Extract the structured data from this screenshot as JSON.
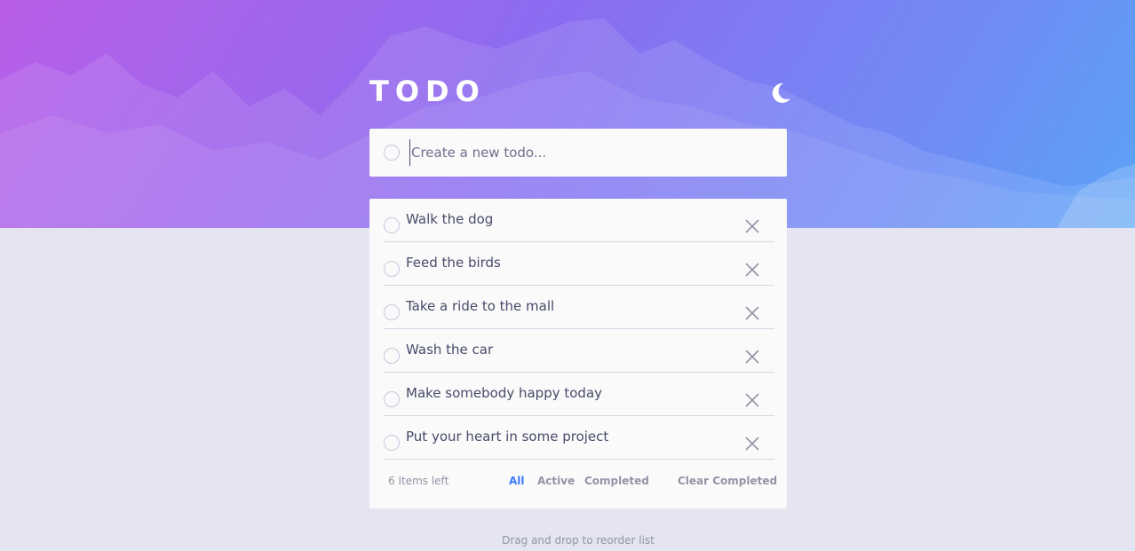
{
  "app": {
    "title": "TODO",
    "theme_icon": "moon-icon"
  },
  "new_todo": {
    "placeholder": "Create a new todo...",
    "value": ""
  },
  "todos": [
    {
      "text": "Walk the dog",
      "completed": false
    },
    {
      "text": "Feed the birds",
      "completed": false
    },
    {
      "text": "Take a ride to the mall",
      "completed": false
    },
    {
      "text": "Wash the car",
      "completed": false
    },
    {
      "text": "Make somebody happy today",
      "completed": false
    },
    {
      "text": "Put your heart in some project",
      "completed": false
    }
  ],
  "footer": {
    "items_left": "6 Items left",
    "filter_all": "All",
    "filter_active": "Active",
    "filter_completed": "Completed",
    "clear_completed": "Clear Completed",
    "active_filter": "All"
  },
  "hint": "Drag and drop to reorder list",
  "colors": {
    "accent": "#3a7bfd",
    "background": "#e4e5f1",
    "card": "#fafafa",
    "text": "#484b6a",
    "muted": "#9394a5",
    "gradient_start": "#b85ee8",
    "gradient_end": "#5aa3f7"
  }
}
